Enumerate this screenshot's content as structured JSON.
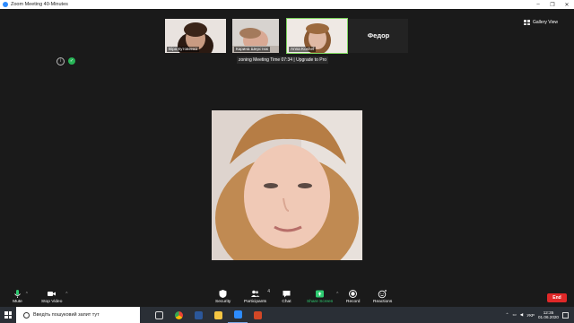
{
  "window": {
    "title": "Zoom Meeting 40-Minutes",
    "controls": [
      "–",
      "❐",
      "✕"
    ]
  },
  "participants": [
    {
      "name": "Віра Кутовенко"
    },
    {
      "name": "Карина Шерстюк"
    },
    {
      "name": "Anna Koshel"
    },
    {
      "name": "Федор",
      "initials": "Федор"
    }
  ],
  "gallery_view_label": "Gallery View",
  "meeting_timer": "zoning Meeting Time 07:34 | Upgrade to Pro",
  "active_speaker": "Anna Koshel",
  "toolbar": {
    "mute": "Mute",
    "stop_video": "Stop Video",
    "security": "Security",
    "participants": "Participants",
    "participants_count": "4",
    "chat": "Chat",
    "share_screen": "Share Screen",
    "record": "Record",
    "reactions": "Reactions",
    "end": "End"
  },
  "taskbar": {
    "search_placeholder": "Введіть пошуковий запит тут",
    "language": "УКР",
    "time": "12:35",
    "date": "01.06.2020"
  },
  "colors": {
    "end_button": "#e02828",
    "share_screen": "#2ecc71",
    "active_outline": "#7bd35c"
  }
}
